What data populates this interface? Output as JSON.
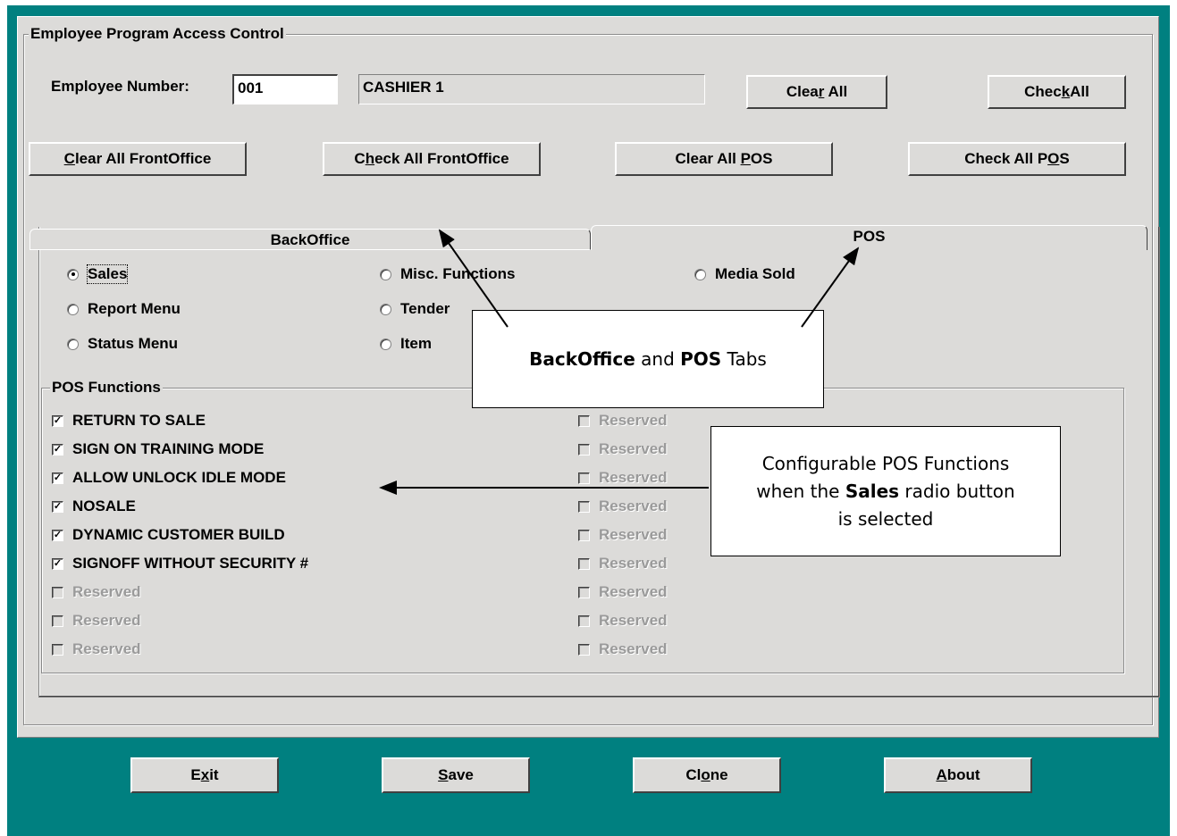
{
  "group_title": "Employee Program Access Control",
  "employee": {
    "label": "Employee Number:",
    "number": "001",
    "name": "CASHIER 1"
  },
  "top_buttons": {
    "clear_all": "Clear All",
    "check_all": "CheckAll",
    "clear_all_frontoffice": "Clear All FrontOffice",
    "check_all_frontoffice": "Check All FrontOffice",
    "clear_all_pos": "Clear All POS",
    "check_all_pos": "Check All POS"
  },
  "tabs": {
    "backoffice": "BackOffice",
    "pos": "POS",
    "active": "POS"
  },
  "radios": [
    {
      "label": "Sales",
      "selected": true
    },
    {
      "label": "Misc. Functions",
      "selected": false
    },
    {
      "label": "Media Sold",
      "selected": false
    },
    {
      "label": "Report Menu",
      "selected": false
    },
    {
      "label": "Tender",
      "selected": false
    },
    {
      "label": "Status Menu",
      "selected": false
    },
    {
      "label": "Item",
      "selected": false
    }
  ],
  "pos_functions": {
    "title": "POS Functions",
    "left": [
      {
        "label": "RETURN TO SALE",
        "checked": true,
        "enabled": true
      },
      {
        "label": "SIGN ON TRAINING MODE",
        "checked": true,
        "enabled": true
      },
      {
        "label": "ALLOW UNLOCK IDLE MODE",
        "checked": true,
        "enabled": true
      },
      {
        "label": "NOSALE",
        "checked": true,
        "enabled": true
      },
      {
        "label": "DYNAMIC CUSTOMER BUILD",
        "checked": true,
        "enabled": true
      },
      {
        "label": "SIGNOFF WITHOUT SECURITY #",
        "checked": true,
        "enabled": true
      },
      {
        "label": "Reserved",
        "checked": false,
        "enabled": false
      },
      {
        "label": "Reserved",
        "checked": false,
        "enabled": false
      },
      {
        "label": "Reserved",
        "checked": false,
        "enabled": false
      }
    ],
    "right": [
      {
        "label": "Reserved",
        "checked": false,
        "enabled": false
      },
      {
        "label": "Reserved",
        "checked": false,
        "enabled": false
      },
      {
        "label": "Reserved",
        "checked": false,
        "enabled": false
      },
      {
        "label": "Reserved",
        "checked": false,
        "enabled": false
      },
      {
        "label": "Reserved",
        "checked": false,
        "enabled": false
      },
      {
        "label": "Reserved",
        "checked": false,
        "enabled": false
      },
      {
        "label": "Reserved",
        "checked": false,
        "enabled": false
      },
      {
        "label": "Reserved",
        "checked": false,
        "enabled": false
      },
      {
        "label": "Reserved",
        "checked": false,
        "enabled": false
      }
    ]
  },
  "callouts": {
    "tabs": {
      "bold1": "BackOffice",
      "mid": " and ",
      "bold2": "POS",
      "end": " Tabs"
    },
    "functions": {
      "line1": "Configurable POS Functions",
      "line2a": "when the ",
      "bold": "Sales",
      "line2b": " radio button",
      "line3": "is selected"
    }
  },
  "bottom_buttons": {
    "exit": "Exit",
    "save": "Save",
    "clone": "Clone",
    "about": "About"
  },
  "colors": {
    "window": "#008080",
    "panel": "#dcdbd9",
    "disabled_text": "#9a9a9a"
  }
}
